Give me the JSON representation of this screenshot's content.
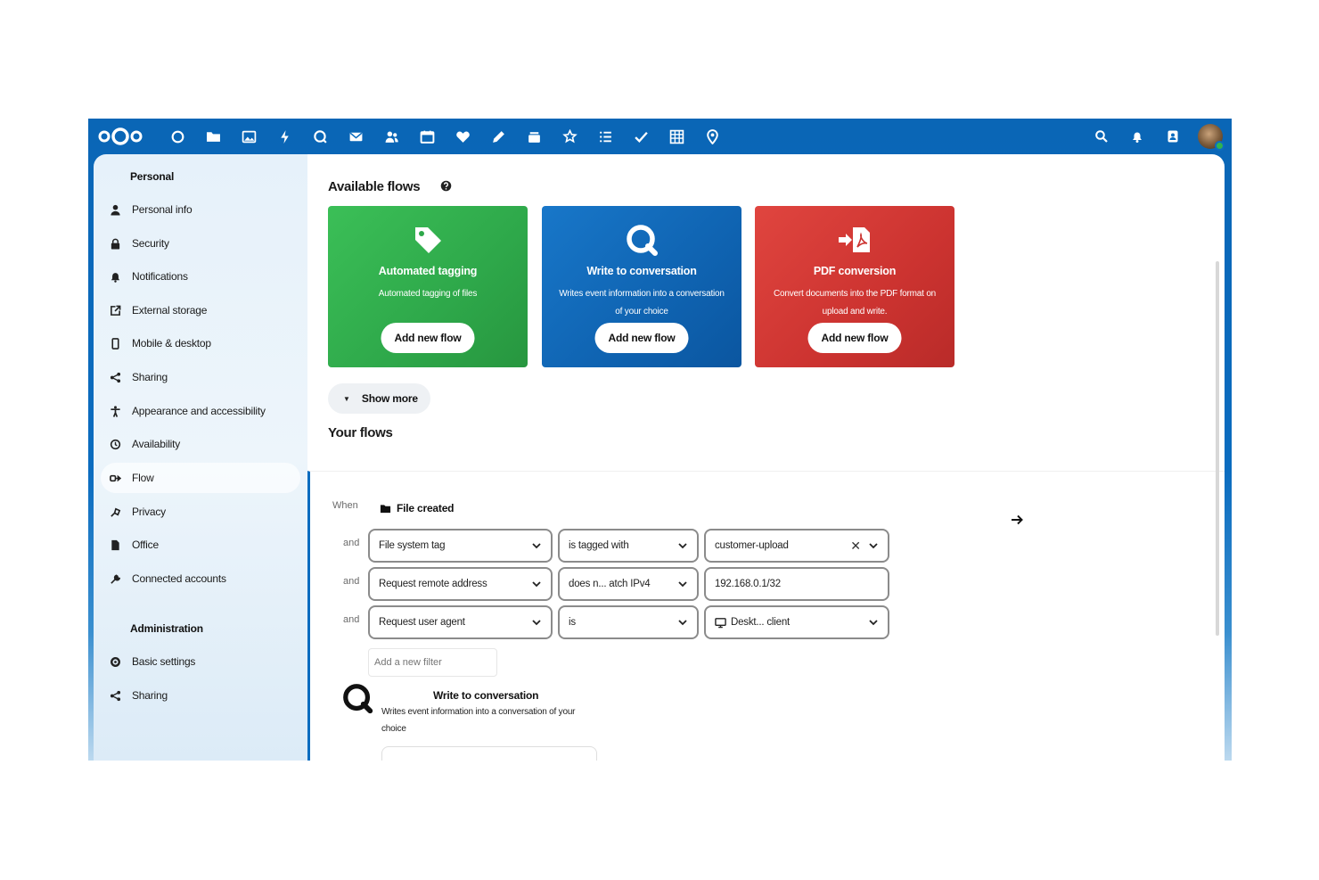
{
  "topbar": {
    "apps": [
      {
        "name": "dashboard-app-icon"
      },
      {
        "name": "files-app-icon"
      },
      {
        "name": "photos-app-icon"
      },
      {
        "name": "activity-app-icon"
      },
      {
        "name": "talk-app-icon"
      },
      {
        "name": "mail-app-icon"
      },
      {
        "name": "contacts-app-icon"
      },
      {
        "name": "calendar-app-icon"
      },
      {
        "name": "health-app-icon"
      },
      {
        "name": "notes-app-icon"
      },
      {
        "name": "deck-app-icon"
      },
      {
        "name": "news-app-icon"
      },
      {
        "name": "list-app-icon"
      },
      {
        "name": "tasks-app-icon"
      },
      {
        "name": "tables-app-icon"
      },
      {
        "name": "maps-app-icon"
      }
    ],
    "right": [
      "search-icon",
      "notifications-icon",
      "contacts-menu-icon",
      "avatar"
    ],
    "accent_color": "#0b6cbf"
  },
  "sidebar": {
    "personal_heading": "Personal",
    "personal_items": [
      {
        "label": "Personal info",
        "icon": "user-icon"
      },
      {
        "label": "Security",
        "icon": "lock-icon"
      },
      {
        "label": "Notifications",
        "icon": "bell-icon"
      },
      {
        "label": "External storage",
        "icon": "external-link-icon"
      },
      {
        "label": "Mobile & desktop",
        "icon": "phone-icon"
      },
      {
        "label": "Sharing",
        "icon": "share-icon"
      },
      {
        "label": "Appearance and accessibility",
        "icon": "accessibility-icon"
      },
      {
        "label": "Availability",
        "icon": "clock-icon"
      },
      {
        "label": "Flow",
        "icon": "flow-icon",
        "active": true
      },
      {
        "label": "Privacy",
        "icon": "privacy-icon"
      },
      {
        "label": "Office",
        "icon": "document-icon"
      },
      {
        "label": "Connected accounts",
        "icon": "wrench-icon"
      }
    ],
    "admin_heading": "Administration",
    "admin_items": [
      {
        "label": "Basic settings",
        "icon": "gear-icon"
      },
      {
        "label": "Sharing",
        "icon": "share-icon"
      }
    ]
  },
  "main": {
    "available_flows_title": "Available flows",
    "cards": [
      {
        "title": "Automated tagging",
        "desc": "Automated tagging of files",
        "button": "Add new flow",
        "color": "#2ea84a",
        "icon": "tag-icon"
      },
      {
        "title": "Write to conversation",
        "desc": "Writes event information into a conversation of your choice",
        "button": "Add new flow",
        "color": "#0f63b1",
        "icon": "talk-icon"
      },
      {
        "title": "PDF conversion",
        "desc": "Convert documents into the PDF format on upload and write.",
        "button": "Add new flow",
        "color": "#cc3330",
        "icon": "pdf-icon"
      }
    ],
    "show_more": "Show more",
    "your_flows_title": "Your flows",
    "rule": {
      "when_label": "When",
      "event": "File created",
      "and_label": "and",
      "checks": [
        {
          "field": "File system tag",
          "operator": "is tagged with",
          "value": "customer-upload"
        },
        {
          "field": "Request remote address",
          "operator": "does n... atch IPv4",
          "value": "192.168.0.1/32"
        },
        {
          "field": "Request user agent",
          "operator": "is",
          "value": "Deskt... client"
        }
      ],
      "add_filter_placeholder": "Add a new filter",
      "action_title": "Write to conversation",
      "action_desc": "Writes event information into a conversation of your choice"
    }
  }
}
